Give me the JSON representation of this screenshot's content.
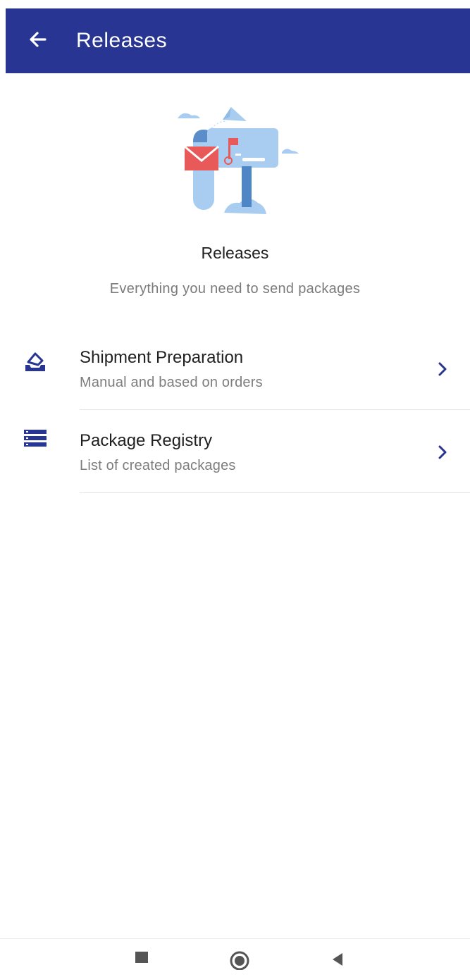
{
  "appbar": {
    "title": "Releases",
    "back_icon": "arrow-left-icon",
    "color": "#283593"
  },
  "hero": {
    "illustration": "mailbox-illustration",
    "title": "Releases",
    "subtitle": "Everything you need to send packages"
  },
  "menu": {
    "items": [
      {
        "icon": "box-eraser-icon",
        "title": "Shipment Preparation",
        "subtitle": "Manual and based on orders",
        "chevron": "chevron-right-icon"
      },
      {
        "icon": "list-stack-icon",
        "title": "Package Registry",
        "subtitle": "List of created packages",
        "chevron": "chevron-right-icon"
      }
    ]
  },
  "colors": {
    "primary": "#283593",
    "icon": "#283593",
    "illustration_blue": "#a9cdf0",
    "illustration_red": "#e85a5a"
  },
  "navbar": {
    "buttons": [
      "recents-square-icon",
      "home-circle-icon",
      "back-triangle-icon"
    ]
  }
}
